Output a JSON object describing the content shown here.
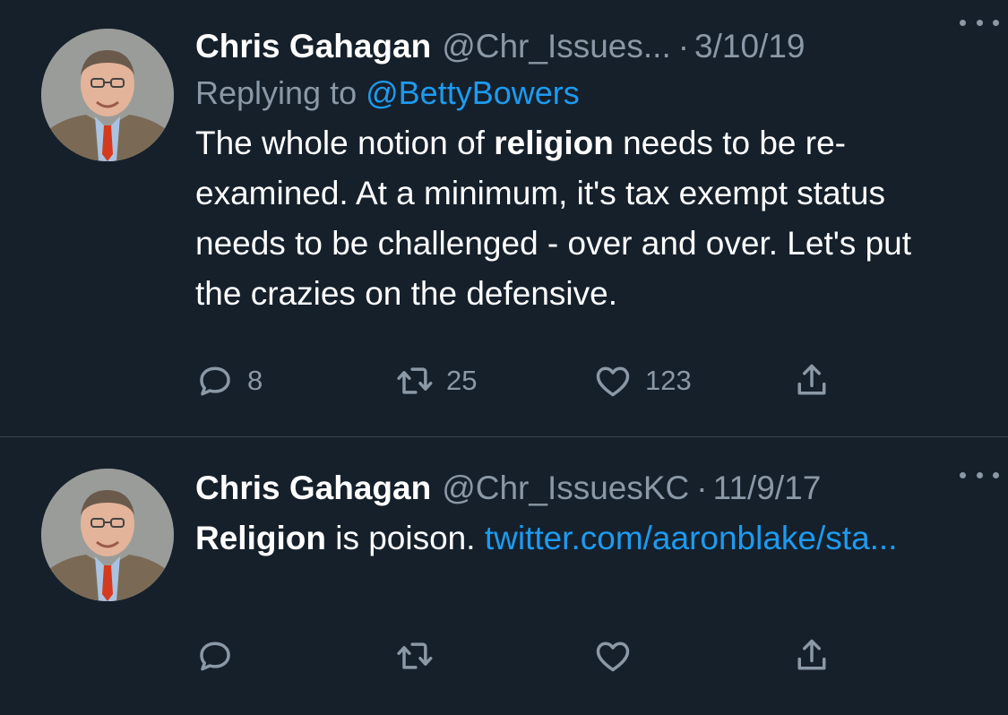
{
  "tweets": [
    {
      "author_name": "Chris Gahagan",
      "handle": "@Chr_Issues...",
      "separator": "·",
      "date": "3/10/19",
      "replying_prefix": "Replying to ",
      "replying_to": "@BettyBowers",
      "text_before": "The whole notion of ",
      "text_bold": "religion",
      "text_after": " needs to be re-examined. At a minimum, it's tax exempt status needs to be challenged - over and over. Let's put the crazies on the defensive.",
      "replies": "8",
      "retweets": "25",
      "likes": "123"
    },
    {
      "author_name": "Chris Gahagan",
      "handle": "@Chr_IssuesKC",
      "separator": "·",
      "date": "11/9/17",
      "text_bold": "Religion",
      "text_after": " is poison. ",
      "link_text": "twitter.com/aaronblake/sta..."
    }
  ],
  "icons": {
    "reply": "reply-icon",
    "retweet": "retweet-icon",
    "like": "heart-icon",
    "share": "share-icon",
    "more": "more-options-icon"
  },
  "colors": {
    "background": "#15202b",
    "secondary_text": "#8b98a5",
    "accent": "#1d9bf0",
    "divider": "#38444d"
  }
}
